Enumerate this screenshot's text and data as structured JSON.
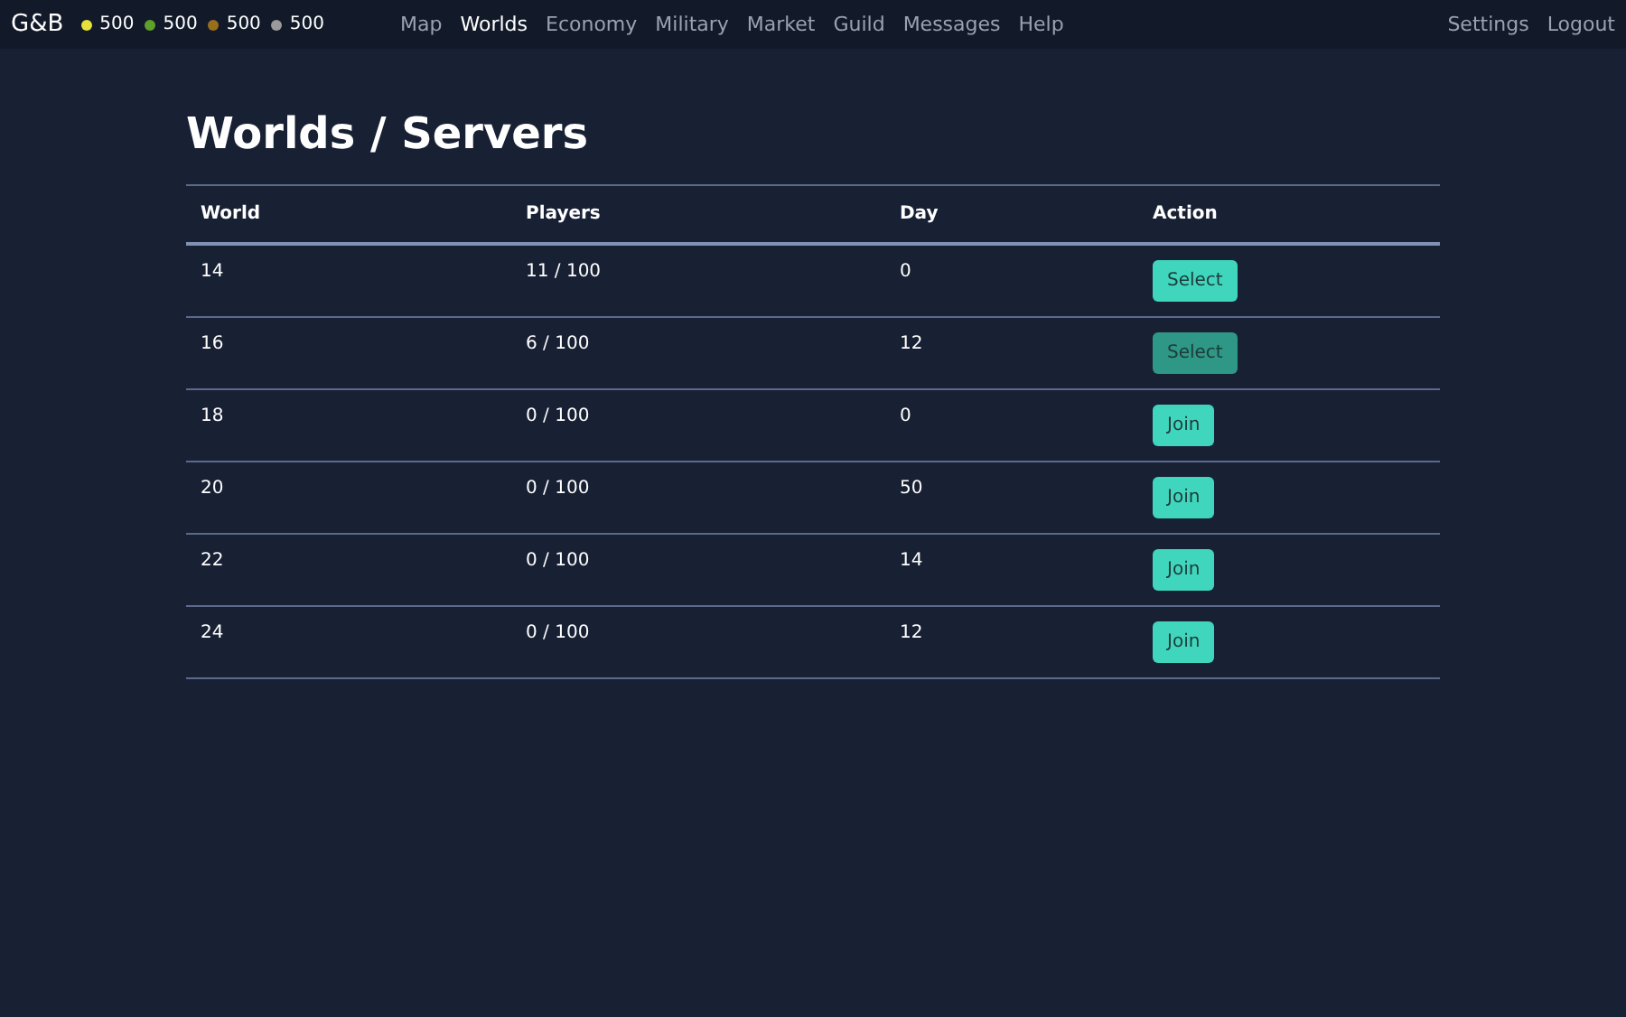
{
  "navbar": {
    "logo": "G&B",
    "resources": [
      {
        "value": "500",
        "color": "#e6e03a"
      },
      {
        "value": "500",
        "color": "#5fa02a"
      },
      {
        "value": "500",
        "color": "#9a6f1c"
      },
      {
        "value": "500",
        "color": "#9a9a9a"
      }
    ],
    "links": [
      {
        "label": "Map",
        "selected": false
      },
      {
        "label": "Worlds",
        "selected": true
      },
      {
        "label": "Economy",
        "selected": false
      },
      {
        "label": "Military",
        "selected": false
      },
      {
        "label": "Market",
        "selected": false
      },
      {
        "label": "Guild",
        "selected": false
      },
      {
        "label": "Messages",
        "selected": false
      },
      {
        "label": "Help",
        "selected": false
      }
    ],
    "right_links": [
      "Settings",
      "Logout"
    ]
  },
  "heading": "Worlds / Servers",
  "table": {
    "columns": [
      "World",
      "Players",
      "Day",
      "Action"
    ],
    "rows": [
      {
        "world": "14",
        "players": "11 / 100",
        "day": "0",
        "action": {
          "label": "Select",
          "selected": false
        }
      },
      {
        "world": "16",
        "players": "6 / 100",
        "day": "12",
        "action": {
          "label": "Select",
          "selected": true
        }
      },
      {
        "world": "18",
        "players": "0 / 100",
        "day": "0",
        "action": {
          "label": "Join",
          "selected": false
        }
      },
      {
        "world": "20",
        "players": "0 / 100",
        "day": "50",
        "action": {
          "label": "Join",
          "selected": false
        }
      },
      {
        "world": "22",
        "players": "0 / 100",
        "day": "14",
        "action": {
          "label": "Join",
          "selected": false
        }
      },
      {
        "world": "24",
        "players": "0 / 100",
        "day": "12",
        "action": {
          "label": "Join",
          "selected": false
        }
      }
    ]
  }
}
